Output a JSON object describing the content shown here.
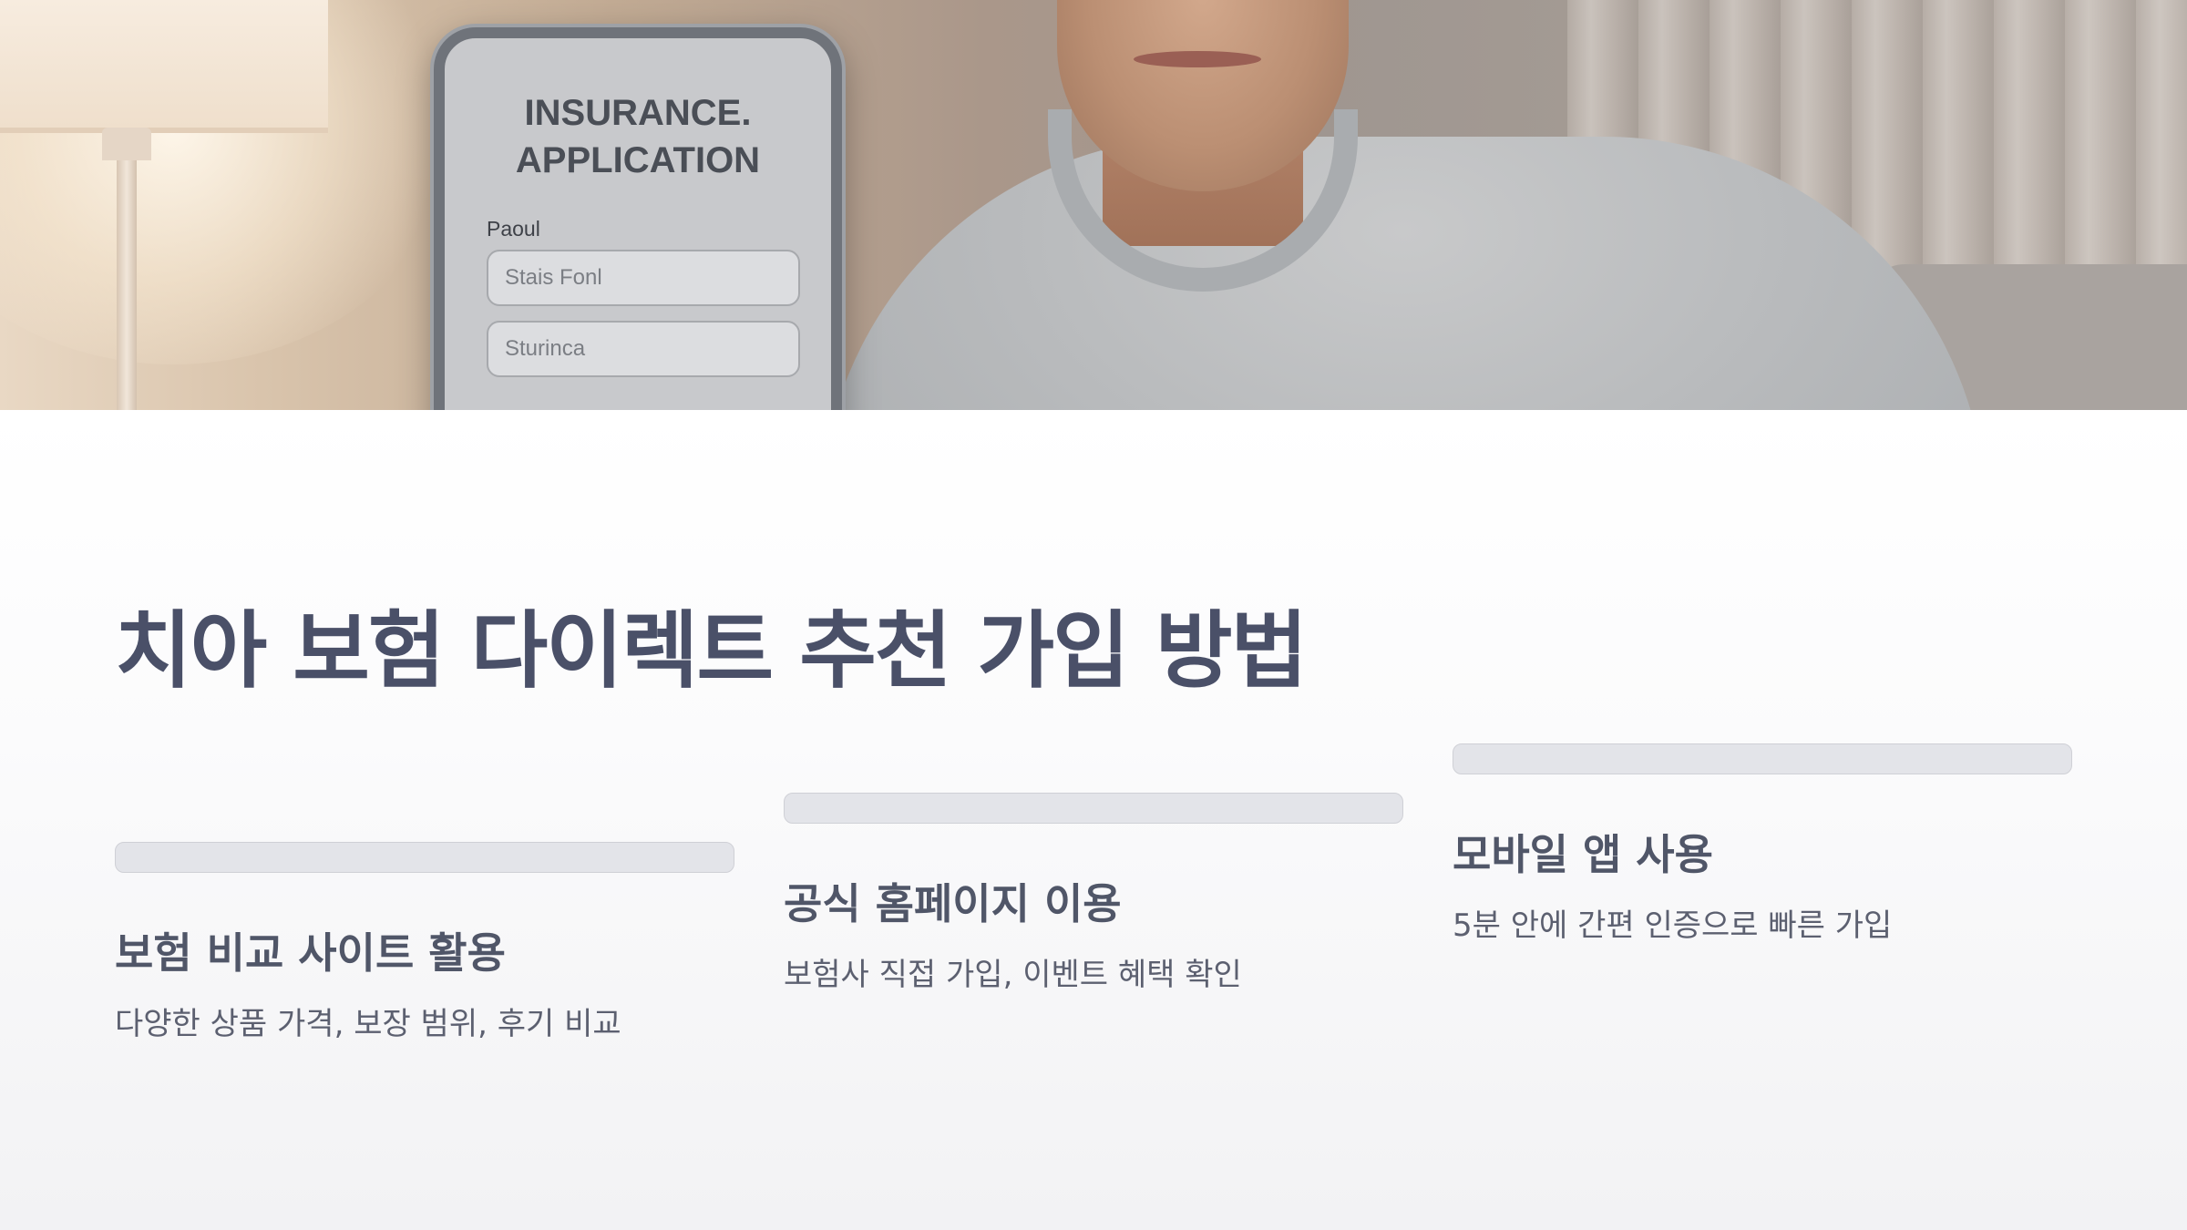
{
  "hero": {
    "phone": {
      "title": "INSURANCE.\nAPPLICATION",
      "label": "Paoul",
      "field_1": "Stais Fonl",
      "field_2": "Sturinca"
    }
  },
  "main": {
    "title": "치아 보험 다이렉트 추천 가입 방법",
    "steps": [
      {
        "title": "보험 비교 사이트 활용",
        "desc": "다양한 상품 가격, 보장 범위, 후기 비교"
      },
      {
        "title": "공식 홈페이지 이용",
        "desc": "보험사 직접 가입, 이벤트 혜택 확인"
      },
      {
        "title": "모바일 앱 사용",
        "desc": "5분 안에 간편 인증으로 빠른 가입"
      }
    ]
  }
}
